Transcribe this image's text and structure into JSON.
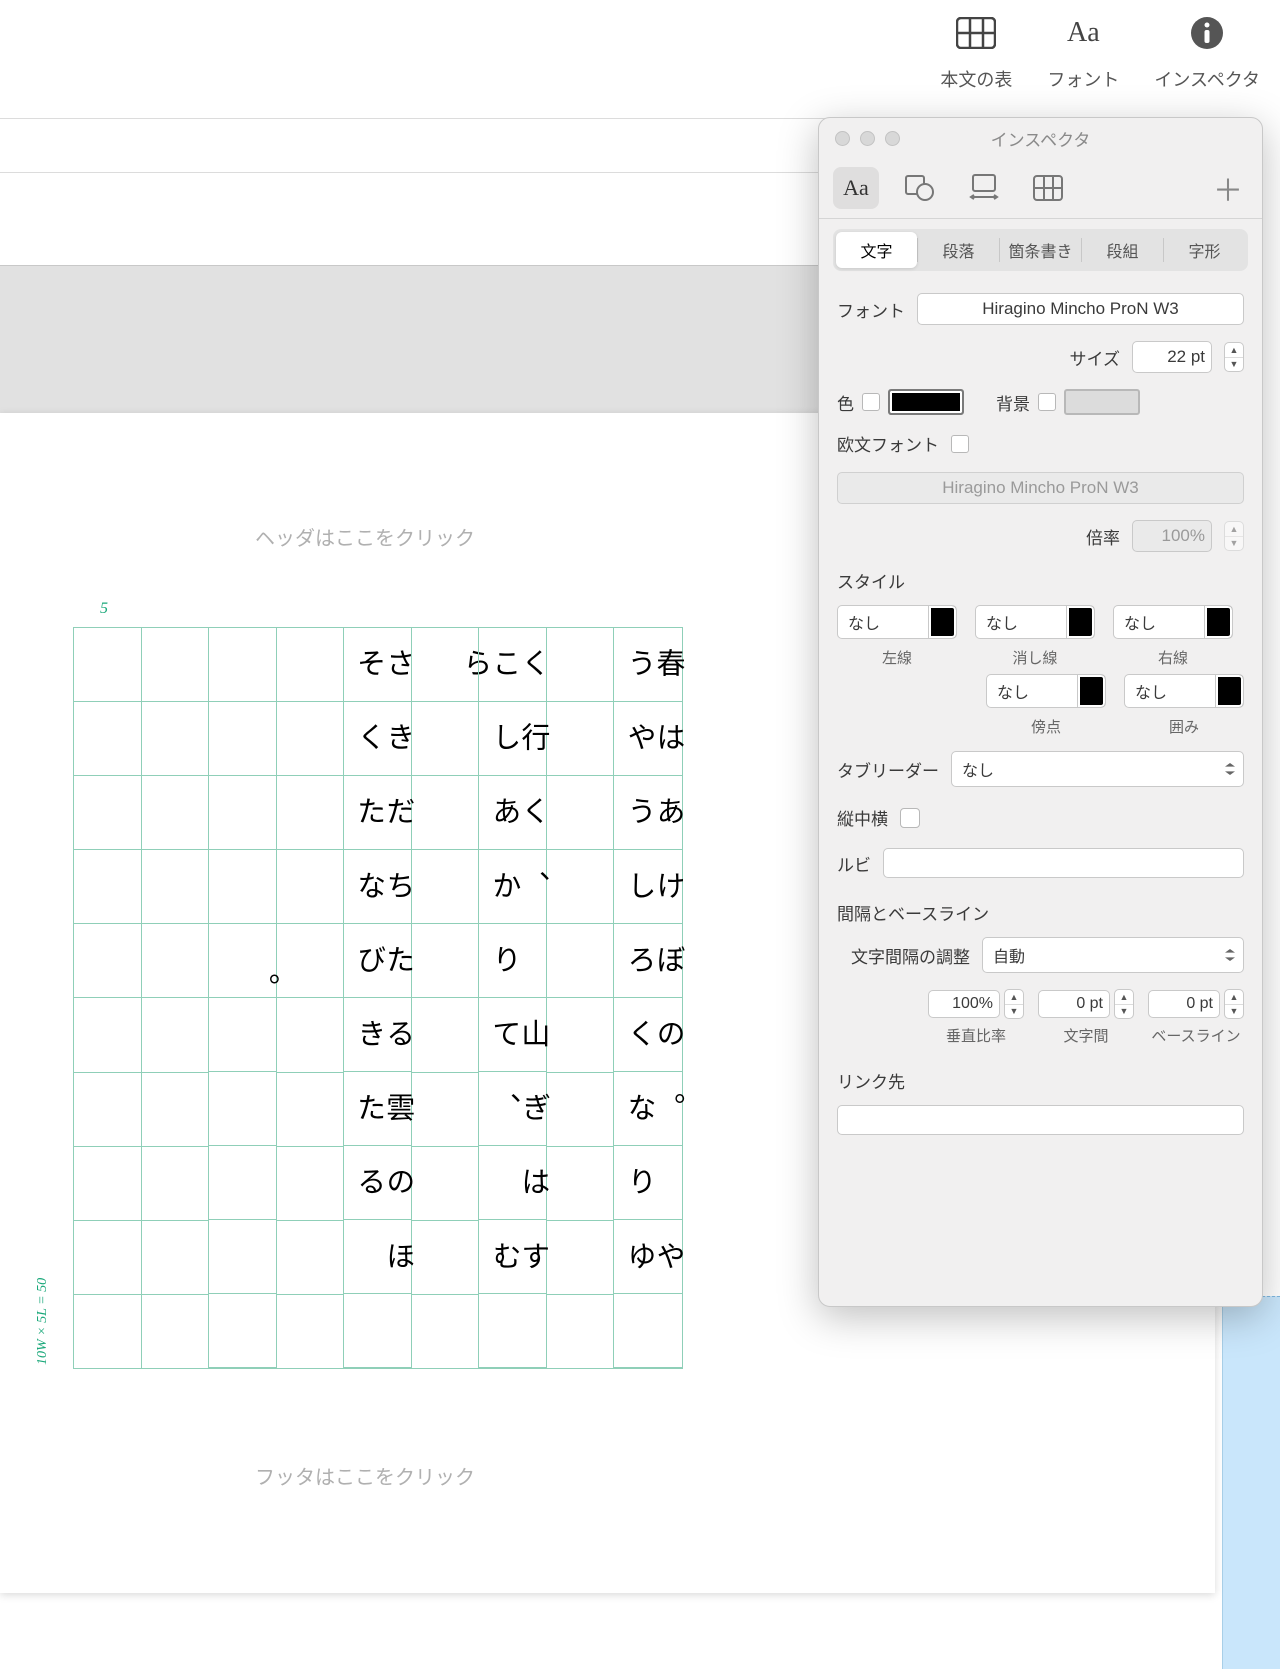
{
  "toolbar": {
    "table": "本文の表",
    "font": "フォント",
    "inspector": "インスペクタ"
  },
  "page": {
    "header_hint": "ヘッダはここをクリック",
    "footer_hint": "フッタはここをクリック",
    "grid_note_top": "5",
    "grid_note_side": "10W × 5L = 50",
    "columns": [
      "春はあけぼの︒",
      "やうやうしろくなりゆ",
      "く行く︑",
      "山ぎはすこしあかりて︑",
      "むら",
      "さきだちたる雲のほそくたなびきたる",
      "︒"
    ]
  },
  "inspector": {
    "title": "インスペクタ",
    "tabs2": {
      "t1": "文字",
      "t2": "段落",
      "t3": "箇条書き",
      "t4": "段組",
      "t5": "字形"
    },
    "font_lbl": "フォント",
    "font_value": "Hiragino Mincho ProN W3",
    "size_lbl": "サイズ",
    "size_value": "22 pt",
    "color_lbl": "色",
    "bg_lbl": "背景",
    "latin_lbl": "欧文フォント",
    "latin_value": "Hiragino Mincho ProN W3",
    "scale_lbl": "倍率",
    "scale_value": "100%",
    "style_lbl": "スタイル",
    "style_none": "なし",
    "left_line": "左線",
    "strike": "消し線",
    "right_line": "右線",
    "bouten": "傍点",
    "kakomi": "囲み",
    "tab_leader_lbl": "タブリーダー",
    "tab_leader_value": "なし",
    "tatechuyoko": "縦中横",
    "ruby_lbl": "ルビ",
    "spacing_lbl": "間隔とベースライン",
    "kerning_lbl": "文字間隔の調整",
    "kerning_value": "自動",
    "vratio": "100%",
    "charspace": "0 pt",
    "baseline": "0 pt",
    "vratio_cap": "垂直比率",
    "charspace_cap": "文字間",
    "baseline_cap": "ベースライン",
    "link_lbl": "リンク先"
  }
}
